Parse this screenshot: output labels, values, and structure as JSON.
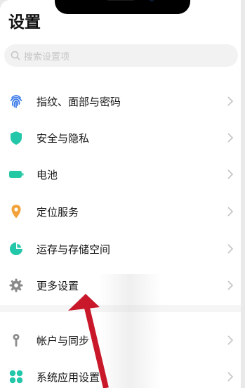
{
  "header": {
    "title": "设置"
  },
  "search": {
    "placeholder": "搜索设置项"
  },
  "items": [
    {
      "label": "指纹、面部与密码",
      "icon": "fingerprint-icon",
      "color": "#3b7be8"
    },
    {
      "label": "安全与隐私",
      "icon": "shield-icon",
      "color": "#21c7a8"
    },
    {
      "label": "电池",
      "icon": "battery-icon",
      "color": "#23c9a3"
    },
    {
      "label": "定位服务",
      "icon": "location-pin-icon",
      "color": "#f2a23a"
    },
    {
      "label": "运存与存储空间",
      "icon": "storage-pie-icon",
      "color": "#21c7a8"
    },
    {
      "label": "更多设置",
      "icon": "gear-icon",
      "color": "#8a8a8a"
    },
    {
      "label": "帐户与同步",
      "icon": "account-key-icon",
      "color": "#8e8e8e"
    },
    {
      "label": "系统应用设置",
      "icon": "apps-grid-icon",
      "color": "#21c7a8"
    }
  ],
  "overlay": {
    "arrow_color": "#c8182a"
  }
}
